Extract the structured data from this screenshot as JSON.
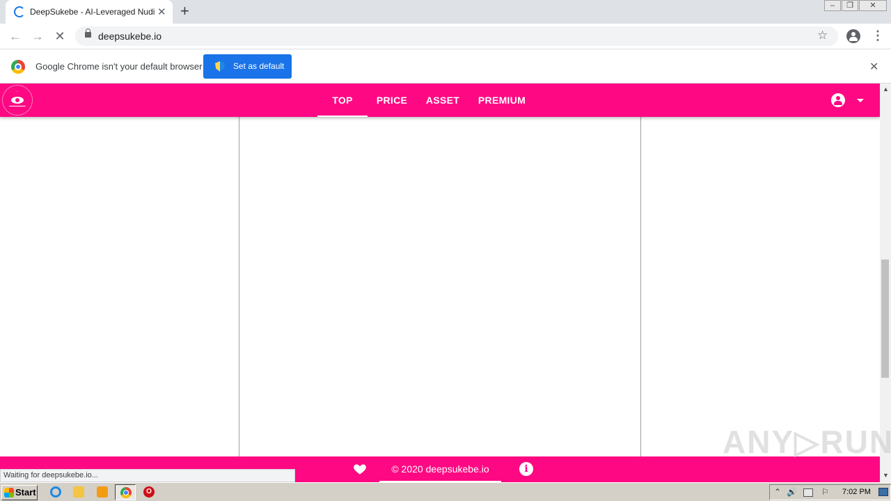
{
  "browser": {
    "tab_title": "DeepSukebe - AI-Leveraged Nudifier",
    "tab_close_glyph": "✕",
    "new_tab_glyph": "+",
    "back_glyph": "←",
    "forward_glyph": "→",
    "stop_glyph": "✕",
    "url": "deepsukebe.io",
    "star_glyph": "☆",
    "menu_glyph": "⋮",
    "window_controls": {
      "minimize": "–",
      "maximize": "❐",
      "close": "✕"
    }
  },
  "infobar": {
    "message": "Google Chrome isn't your default browser",
    "button_label": "Set as default",
    "close_glyph": "✕"
  },
  "site": {
    "nav_tabs": [
      {
        "label": "TOP",
        "active": true
      },
      {
        "label": "PRICE",
        "active": false
      },
      {
        "label": "ASSET",
        "active": false
      },
      {
        "label": "PREMIUM",
        "active": false
      }
    ],
    "footer_copyright": "© 2020 deepsukebe.io",
    "info_glyph": "i"
  },
  "status_bubble": "Waiting for deepsukebe.io...",
  "watermark": "ANY▷RUN",
  "scrollbar": {
    "up": "▲",
    "down": "▼"
  },
  "taskbar": {
    "start_label": "Start",
    "opera_glyph": "O",
    "tray": {
      "up": "⌃",
      "speaker": "🔊",
      "flag": "⚐"
    },
    "clock": "7:02 PM"
  },
  "colors": {
    "brand": "#ff0883",
    "chrome_blue": "#1a73e8"
  }
}
